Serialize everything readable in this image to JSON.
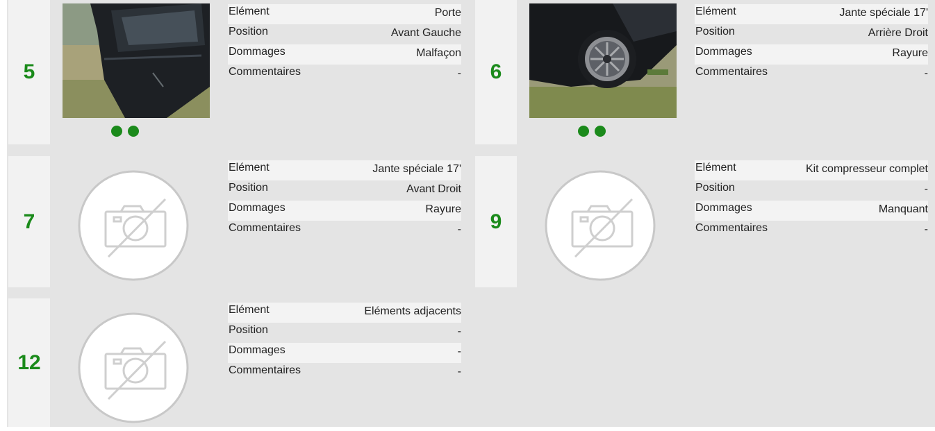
{
  "labels": {
    "element": "Elément",
    "position": "Position",
    "dommages": "Dommages",
    "commentaires": "Commentaires"
  },
  "cards": [
    {
      "number": "5",
      "element": "Porte",
      "position": "Avant Gauche",
      "dommages": "Malfaçon",
      "commentaires": "-",
      "has_photo": true,
      "photo_dots": 2
    },
    {
      "number": "6",
      "element": "Jante spéciale 17'",
      "position": "Arrière Droit",
      "dommages": "Rayure",
      "commentaires": "-",
      "has_photo": true,
      "photo_dots": 2
    },
    {
      "number": "7",
      "element": "Jante spéciale 17'",
      "position": "Avant Droit",
      "dommages": "Rayure",
      "commentaires": "-",
      "has_photo": false
    },
    {
      "number": "9",
      "element": "Kit compresseur complet",
      "position": "-",
      "dommages": "Manquant",
      "commentaires": "-",
      "has_photo": false
    },
    {
      "number": "12",
      "element": "Eléments adjacents",
      "position": "-",
      "dommages": "-",
      "commentaires": "-",
      "has_photo": false
    }
  ],
  "colors": {
    "accent_green": "#1a8a1a",
    "background": "#e4e4e4",
    "number_panel": "#f2f2f2"
  },
  "icons": {
    "no_photo": "camera-off-icon",
    "carousel_dot": "dot-icon"
  }
}
